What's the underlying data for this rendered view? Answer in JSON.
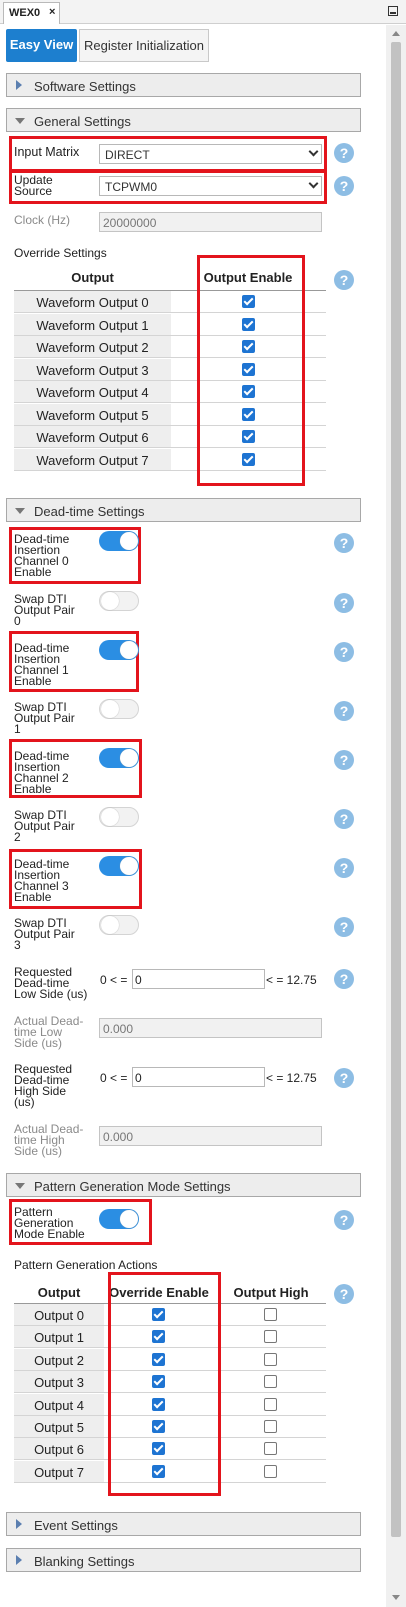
{
  "window": {
    "tab_title": "WEX0",
    "tab_close": "×"
  },
  "view_tabs": {
    "easy_view": "Easy View",
    "register_init": "Register Initialization"
  },
  "sections": {
    "software": "Software Settings",
    "general": "General Settings",
    "dead_time": "Dead-time Settings",
    "pattern": "Pattern Generation Mode Settings",
    "event": "Event Settings",
    "blanking": "Blanking Settings"
  },
  "general": {
    "input_matrix_label": "Input Matrix",
    "input_matrix_value": "DIRECT",
    "update_source_label_1": "Update",
    "update_source_label_2": "Source",
    "update_source_value": "TCPWM0",
    "clock_label": "Clock (Hz)",
    "clock_value": "20000000",
    "override_label": "Override Settings",
    "col_output": "Output",
    "col_output_enable": "Output Enable",
    "outputs": [
      {
        "name": "Waveform Output 0",
        "enabled": true
      },
      {
        "name": "Waveform Output 1",
        "enabled": true
      },
      {
        "name": "Waveform Output 2",
        "enabled": true
      },
      {
        "name": "Waveform Output 3",
        "enabled": true
      },
      {
        "name": "Waveform Output 4",
        "enabled": true
      },
      {
        "name": "Waveform Output 5",
        "enabled": true
      },
      {
        "name": "Waveform Output 6",
        "enabled": true
      },
      {
        "name": "Waveform Output 7",
        "enabled": true
      }
    ]
  },
  "dead_time": {
    "dti0": [
      "Dead-time",
      "Insertion",
      "Channel 0",
      "Enable"
    ],
    "swap0": [
      "Swap DTI",
      "Output Pair",
      "0"
    ],
    "dti1": [
      "Dead-time",
      "Insertion",
      "Channel 1",
      "Enable"
    ],
    "swap1": [
      "Swap DTI",
      "Output Pair",
      "1"
    ],
    "dti2": [
      "Dead-time",
      "Insertion",
      "Channel 2",
      "Enable"
    ],
    "swap2": [
      "Swap DTI",
      "Output Pair",
      "2"
    ],
    "dti3": [
      "Dead-time",
      "Insertion",
      "Channel 3",
      "Enable"
    ],
    "swap3": [
      "Swap DTI",
      "Output Pair",
      "3"
    ],
    "dti_enabled": [
      true,
      true,
      true,
      true
    ],
    "swap_enabled": [
      false,
      false,
      false,
      false
    ],
    "req_low": [
      "Requested",
      "Dead-time",
      "Low Side (us)"
    ],
    "req_low_min": "0 < =",
    "req_low_value": "0",
    "req_low_max": "< = 12.75",
    "act_low": [
      "Actual Dead-",
      "time Low",
      "Side (us)"
    ],
    "act_low_value": "0.000",
    "req_high": [
      "Requested",
      "Dead-time",
      "High Side",
      "(us)"
    ],
    "req_high_min": "0 < =",
    "req_high_value": "0",
    "req_high_max": "< = 12.75",
    "act_high": [
      "Actual Dead-",
      "time High",
      "Side (us)"
    ],
    "act_high_value": "0.000"
  },
  "pattern": {
    "enable_label": [
      "Pattern",
      "Generation",
      "Mode Enable"
    ],
    "enabled": true,
    "actions_label": "Pattern Generation Actions",
    "col_output": "Output",
    "col_override": "Override Enable",
    "col_high": "Output High",
    "rows": [
      {
        "name": "Output 0",
        "override": true,
        "high": false
      },
      {
        "name": "Output 1",
        "override": true,
        "high": false
      },
      {
        "name": "Output 2",
        "override": true,
        "high": false
      },
      {
        "name": "Output 3",
        "override": true,
        "high": false
      },
      {
        "name": "Output 4",
        "override": true,
        "high": false
      },
      {
        "name": "Output 5",
        "override": true,
        "high": false
      },
      {
        "name": "Output 6",
        "override": true,
        "high": false
      },
      {
        "name": "Output 7",
        "override": true,
        "high": false
      }
    ]
  },
  "help_glyph": "?",
  "colors": {
    "accent": "#1d7fcf",
    "highlight": "#e3141c",
    "toggle_on": "#2b8ee3",
    "help": "#8dbde4"
  }
}
